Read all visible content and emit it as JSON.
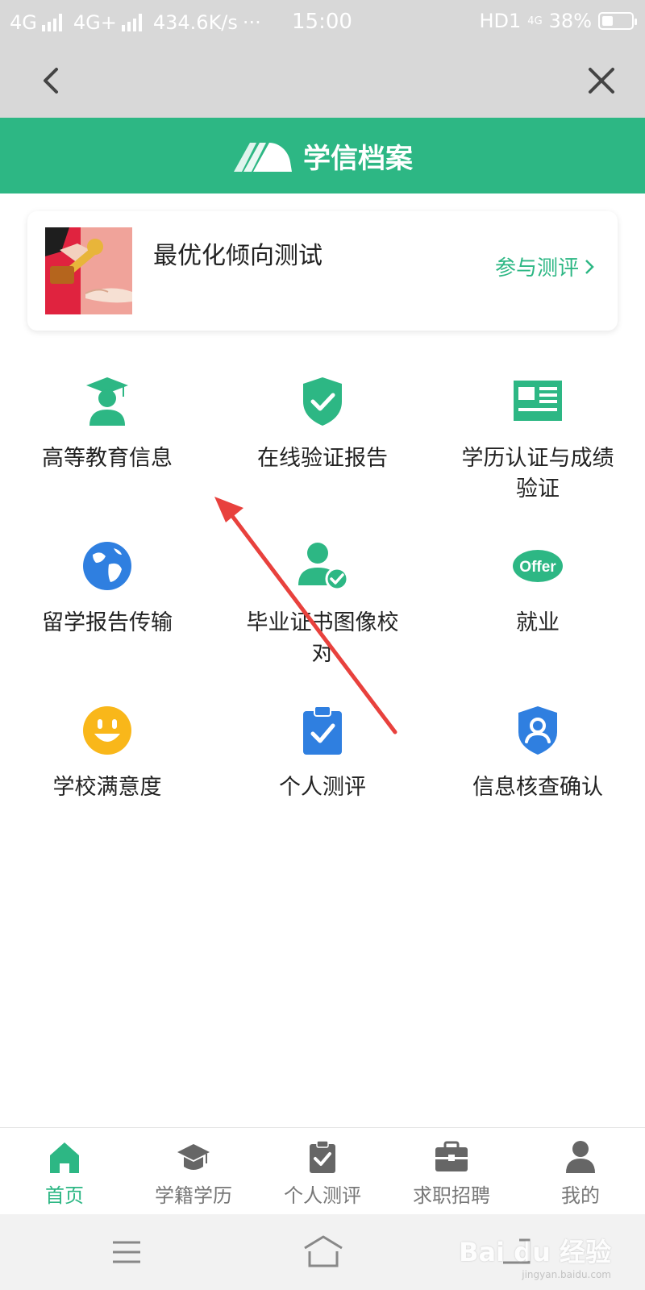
{
  "status_bar": {
    "net1": "4G",
    "net2": "4G+",
    "speed": "434.6K/s",
    "more": "···",
    "time": "15:00",
    "hd": "HD1",
    "net_badge": "4G",
    "battery": "38%",
    "battery_level": 0.38
  },
  "header": {
    "brand": "学信档案"
  },
  "promo": {
    "title": "最优化倾向测试",
    "cta": "参与测评"
  },
  "grid": {
    "items": [
      {
        "label": "高等教育信息",
        "icon": "graduate-icon",
        "color": "#2db784"
      },
      {
        "label": "在线验证报告",
        "icon": "shield-check-icon",
        "color": "#2db784"
      },
      {
        "label": "学历认证与成绩验证",
        "icon": "id-card-icon",
        "color": "#2db784"
      },
      {
        "label": "留学报告传输",
        "icon": "globe-icon",
        "color": "#2f7fe0"
      },
      {
        "label": "毕业证书图像校对",
        "icon": "user-check-icon",
        "color": "#2db784"
      },
      {
        "label": "就业",
        "icon": "offer-icon",
        "color": "#2db784",
        "icon_text": "Offer"
      },
      {
        "label": "学校满意度",
        "icon": "smiley-icon",
        "color": "#f9b71a"
      },
      {
        "label": "个人测评",
        "icon": "clipboard-check-icon",
        "color": "#2f7fe0"
      },
      {
        "label": "信息核查确认",
        "icon": "shield-user-icon",
        "color": "#2f7fe0"
      }
    ]
  },
  "tabs": [
    {
      "label": "首页",
      "icon": "home-icon",
      "active": true
    },
    {
      "label": "学籍学历",
      "icon": "graduation-cap-icon",
      "active": false
    },
    {
      "label": "个人测评",
      "icon": "clipboard-icon",
      "active": false
    },
    {
      "label": "求职招聘",
      "icon": "briefcase-icon",
      "active": false
    },
    {
      "label": "我的",
      "icon": "person-icon",
      "active": false
    }
  ],
  "colors": {
    "brand_green": "#2db784",
    "blue": "#2f7fe0",
    "yellow": "#f9b71a",
    "annotation_red": "#e8413d"
  },
  "watermark": {
    "text": "Bai du 经验",
    "sub": "jingyan.baidu.com"
  }
}
